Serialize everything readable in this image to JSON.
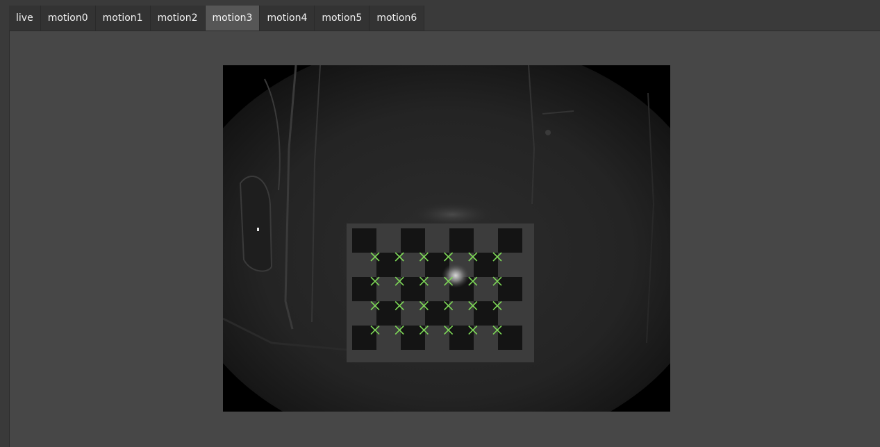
{
  "tabs": [
    {
      "label": "live",
      "active": false
    },
    {
      "label": "motion0",
      "active": false
    },
    {
      "label": "motion1",
      "active": false
    },
    {
      "label": "motion2",
      "active": false
    },
    {
      "label": "motion3",
      "active": true
    },
    {
      "label": "motion4",
      "active": false
    },
    {
      "label": "motion5",
      "active": false
    },
    {
      "label": "motion6",
      "active": false
    }
  ],
  "colors": {
    "marker": "#7ed957",
    "active_tab": "#565656",
    "inactive_tab": "#333333",
    "panel": "#474747"
  },
  "camera_view": {
    "content": "grayscale fisheye camera frame of a calibration checkerboard with detected corner markers",
    "marker_icon": "x-marker-icon",
    "marker_rows": 4,
    "marker_cols": 6
  }
}
